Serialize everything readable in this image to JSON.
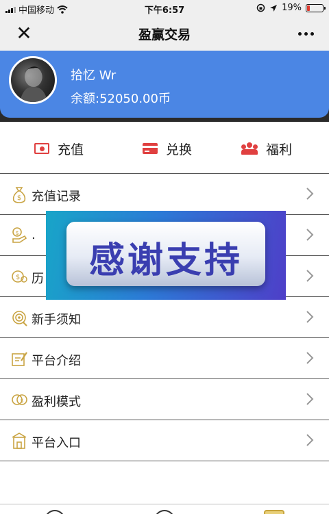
{
  "status_bar": {
    "carrier": "中国移动",
    "time": "下午6:57",
    "battery_text": "19%",
    "battery_level": 0.19,
    "battery_color": "#e23b30"
  },
  "nav": {
    "title": "盈赢交易",
    "close_icon": "close-icon",
    "more_icon": "more-icon"
  },
  "profile": {
    "username": "拾忆 Wr",
    "balance": "余额:52050.00币",
    "card_color": "#4b86e4"
  },
  "actions": [
    {
      "label": "充值",
      "icon": "money-icon"
    },
    {
      "label": "兑换",
      "icon": "card-icon"
    },
    {
      "label": "福利",
      "icon": "users-icon"
    }
  ],
  "menu": [
    {
      "label": "充值记录",
      "icon": "money-bag-icon"
    },
    {
      "label": ".",
      "icon": "coin-hand-icon"
    },
    {
      "label": "历",
      "icon": "history-icon"
    },
    {
      "label": "新手须知",
      "icon": "target-icon"
    },
    {
      "label": "平台介绍",
      "icon": "note-icon"
    },
    {
      "label": "盈利模式",
      "icon": "coins-icon"
    },
    {
      "label": "平台入口",
      "icon": "building-icon"
    }
  ],
  "banner": {
    "text": "感谢支持"
  },
  "colors": {
    "accent_red": "#e04040",
    "icon_gold": "#c9a443"
  }
}
